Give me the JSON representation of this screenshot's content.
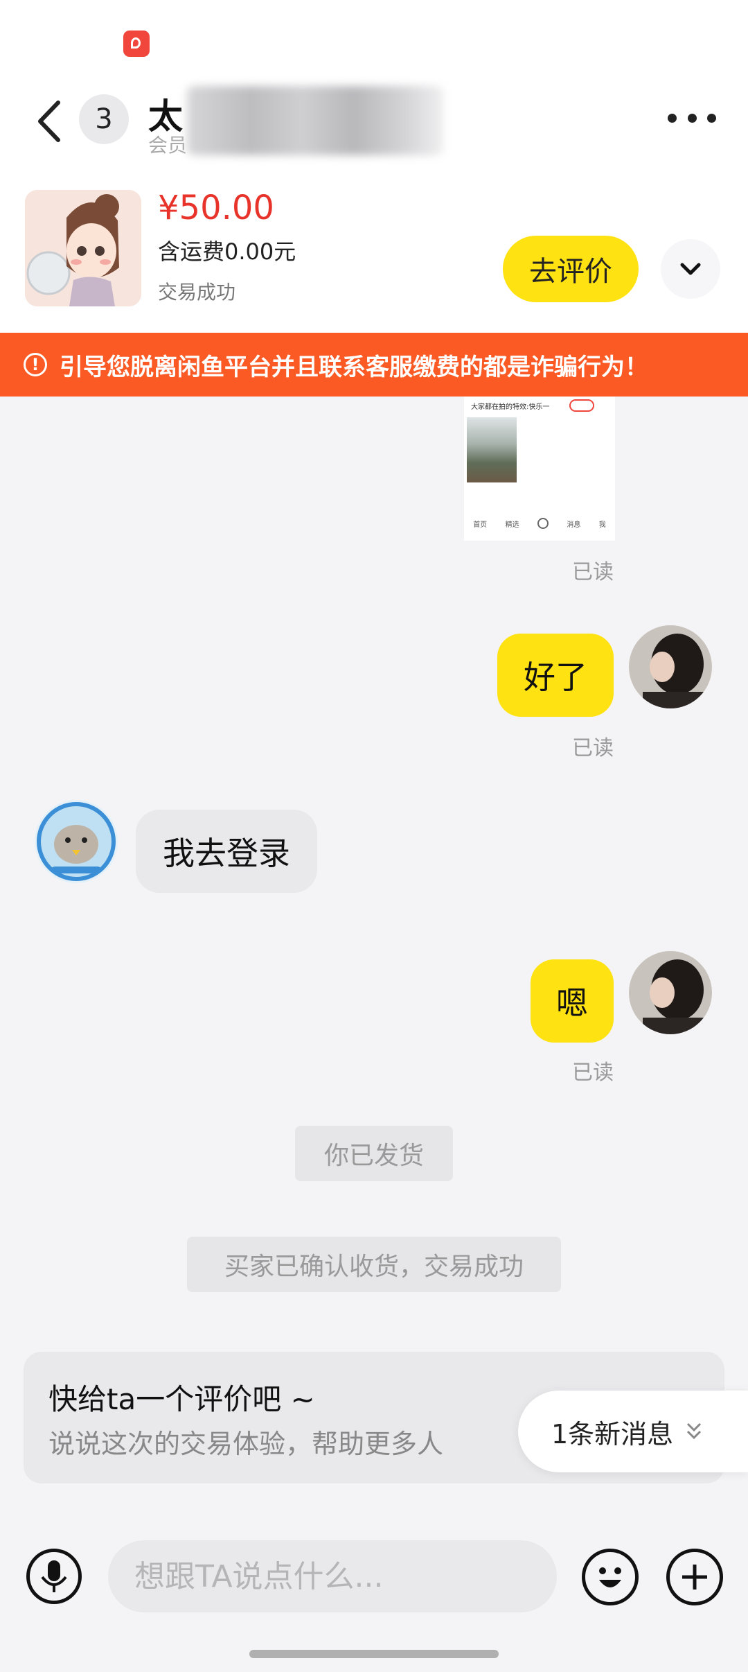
{
  "header": {
    "unread_count": "3",
    "title": "太",
    "subtitle": "会员"
  },
  "product": {
    "price": "¥50.00",
    "shipping": "含运费0.00元",
    "status": "交易成功",
    "review_button": "去评价"
  },
  "warning": {
    "text": "引导您脱离闲鱼平台并且联系客服缴费的都是诈骗行为！"
  },
  "messages": [
    {
      "type": "image",
      "from": "me",
      "read": "已读",
      "preview_text": "大家都在拍的特效:快乐一",
      "preview_tabs": [
        "首页",
        "精选",
        "消息",
        "我"
      ]
    },
    {
      "type": "text",
      "from": "me",
      "text": "好了",
      "read": "已读"
    },
    {
      "type": "text",
      "from": "them",
      "text": "我去登录"
    },
    {
      "type": "text",
      "from": "me",
      "text": "嗯",
      "read": "已读"
    }
  ],
  "system_notes": [
    "你已发货",
    "买家已确认收货，交易成功"
  ],
  "review_prompt": {
    "title": "快给ta一个评价吧 ~",
    "subtitle": "说说这次的交易体验，帮助更多人"
  },
  "new_message_pill": "1条新消息",
  "input": {
    "placeholder": "想跟TA说点什么..."
  },
  "icons": [
    "back-icon",
    "more-icon",
    "chevron-down-icon",
    "alert-icon",
    "mic-icon",
    "emoji-icon",
    "plus-icon"
  ],
  "colors": {
    "accent_yellow": "#ffe211",
    "warning_orange": "#fb5a24",
    "price_red": "#e8332a"
  }
}
